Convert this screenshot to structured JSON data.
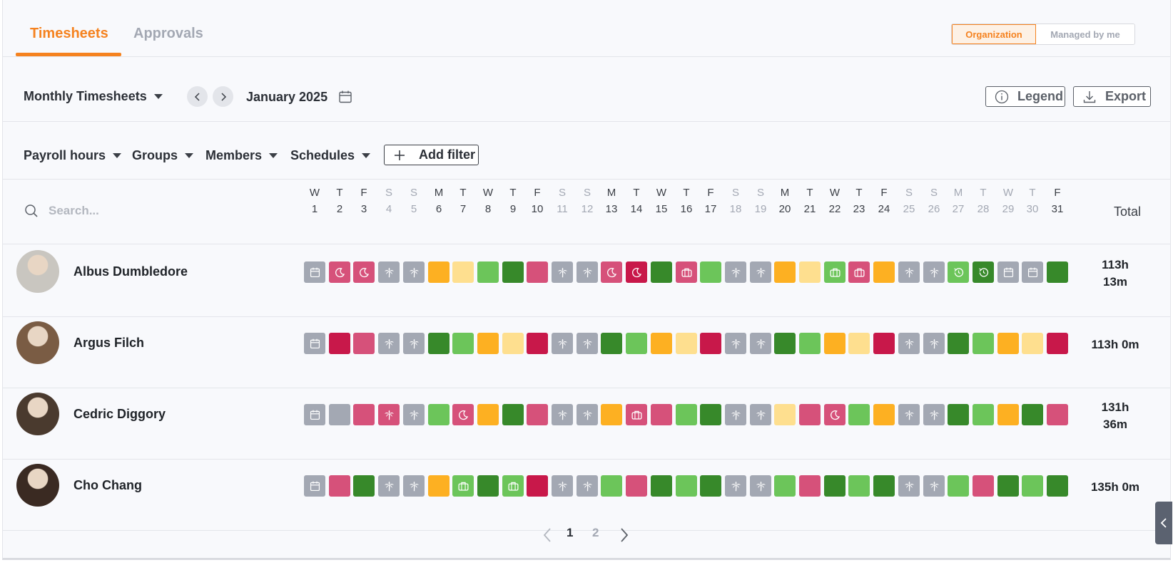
{
  "tabs": [
    {
      "label": "Timesheets",
      "active": true
    },
    {
      "label": "Approvals",
      "active": false
    }
  ],
  "scope_toggle": {
    "organization": "Organization",
    "managed": "Managed by me"
  },
  "toolbar": {
    "view": "Monthly Timesheets",
    "month": "January 2025",
    "legend": "Legend",
    "export": "Export"
  },
  "filters": {
    "payroll": "Payroll hours",
    "groups": "Groups",
    "members": "Members",
    "schedules": "Schedules",
    "add": "Add filter"
  },
  "search": {
    "placeholder": "Search..."
  },
  "days": [
    {
      "w": "W",
      "d": "1",
      "we": false
    },
    {
      "w": "T",
      "d": "2",
      "we": false
    },
    {
      "w": "F",
      "d": "3",
      "we": false
    },
    {
      "w": "S",
      "d": "4",
      "we": true
    },
    {
      "w": "S",
      "d": "5",
      "we": true
    },
    {
      "w": "M",
      "d": "6",
      "we": false
    },
    {
      "w": "T",
      "d": "7",
      "we": false
    },
    {
      "w": "W",
      "d": "8",
      "we": false
    },
    {
      "w": "T",
      "d": "9",
      "we": false
    },
    {
      "w": "F",
      "d": "10",
      "we": false
    },
    {
      "w": "S",
      "d": "11",
      "we": true
    },
    {
      "w": "S",
      "d": "12",
      "we": true
    },
    {
      "w": "M",
      "d": "13",
      "we": false
    },
    {
      "w": "T",
      "d": "14",
      "we": false
    },
    {
      "w": "W",
      "d": "15",
      "we": false
    },
    {
      "w": "T",
      "d": "16",
      "we": false
    },
    {
      "w": "F",
      "d": "17",
      "we": false
    },
    {
      "w": "S",
      "d": "18",
      "we": true
    },
    {
      "w": "S",
      "d": "19",
      "we": true
    },
    {
      "w": "M",
      "d": "20",
      "we": false
    },
    {
      "w": "T",
      "d": "21",
      "we": false
    },
    {
      "w": "W",
      "d": "22",
      "we": false
    },
    {
      "w": "T",
      "d": "23",
      "we": false
    },
    {
      "w": "F",
      "d": "24",
      "we": false
    },
    {
      "w": "S",
      "d": "25",
      "we": true
    },
    {
      "w": "S",
      "d": "26",
      "we": true
    },
    {
      "w": "M",
      "d": "27",
      "we": true
    },
    {
      "w": "T",
      "d": "28",
      "we": true
    },
    {
      "w": "W",
      "d": "29",
      "we": true
    },
    {
      "w": "T",
      "d": "30",
      "we": true
    },
    {
      "w": "F",
      "d": "31",
      "we": false
    }
  ],
  "total_header": "Total",
  "palette": {
    "gray": "#a3a8b3",
    "pink": "#d6517a",
    "crimson": "#c8184a",
    "orange": "#fdb022",
    "lightorange": "#fedf8f",
    "lightgreen": "#6cc55a",
    "darkgreen": "#37892a"
  },
  "members": [
    {
      "name": "Albus Dumbledore",
      "total": [
        "113h",
        "13m"
      ],
      "avatar_color": "#c9c6c0",
      "cells": [
        "gray:calendar",
        "pink:moon",
        "pink:moon",
        "gray:palm",
        "gray:palm",
        "orange:",
        "lightorange:",
        "lightgreen:",
        "darkgreen:",
        "pink:",
        "gray:palm",
        "gray:palm",
        "pink:moon",
        "crimson:moon",
        "darkgreen:",
        "pink:suitcase",
        "lightgreen:",
        "gray:palm",
        "gray:palm",
        "orange:",
        "lightorange:",
        "lightgreen:suitcase",
        "pink:suitcase",
        "orange:",
        "gray:palm",
        "gray:palm",
        "lightgreen:clock",
        "darkgreen:clock",
        "gray:calendar",
        "gray:calendar",
        "darkgreen:"
      ]
    },
    {
      "name": "Argus Filch",
      "total": [
        "113h 0m"
      ],
      "avatar_color": "#7a5c44",
      "cells": [
        "gray:calendar",
        "crimson:",
        "pink:",
        "gray:palm",
        "gray:palm",
        "darkgreen:",
        "lightgreen:",
        "orange:",
        "lightorange:",
        "crimson:",
        "gray:palm",
        "gray:palm",
        "darkgreen:",
        "lightgreen:",
        "orange:",
        "lightorange:",
        "crimson:",
        "gray:palm",
        "gray:palm",
        "darkgreen:",
        "lightgreen:",
        "orange:",
        "lightorange:",
        "crimson:",
        "gray:palm",
        "gray:palm",
        "darkgreen:",
        "lightgreen:",
        "orange:",
        "lightorange:",
        "crimson:"
      ]
    },
    {
      "name": "Cedric Diggory",
      "total": [
        "131h",
        "36m"
      ],
      "avatar_color": "#4a3a2e",
      "cells": [
        "gray:calendar",
        "gray:",
        "pink:",
        "pink:palm",
        "gray:palm",
        "lightgreen:",
        "pink:moon",
        "orange:",
        "darkgreen:",
        "pink:",
        "gray:palm",
        "gray:palm",
        "orange:",
        "pink:suitcase",
        "pink:",
        "lightgreen:",
        "darkgreen:",
        "gray:palm",
        "gray:palm",
        "lightorange:",
        "pink:",
        "pink:moon",
        "lightgreen:",
        "orange:",
        "gray:palm",
        "gray:palm",
        "darkgreen:",
        "lightgreen:",
        "orange:",
        "darkgreen:",
        "pink:"
      ]
    },
    {
      "name": "Cho Chang",
      "total": [
        "135h 0m"
      ],
      "avatar_color": "#3a2a22",
      "cells": [
        "gray:calendar",
        "pink:",
        "darkgreen:",
        "gray:palm",
        "gray:palm",
        "orange:",
        "lightgreen:suitcase",
        "darkgreen:",
        "lightgreen:suitcase",
        "crimson:",
        "gray:palm",
        "gray:palm",
        "lightgreen:",
        "pink:",
        "darkgreen:",
        "lightgreen:",
        "darkgreen:",
        "gray:palm",
        "gray:palm",
        "lightgreen:",
        "pink:",
        "darkgreen:",
        "lightgreen:",
        "darkgreen:",
        "gray:palm",
        "gray:palm",
        "lightgreen:",
        "pink:",
        "darkgreen:",
        "lightgreen:",
        "darkgreen:"
      ]
    }
  ],
  "pagination": {
    "pages": [
      "1",
      "2"
    ],
    "current": "1"
  }
}
